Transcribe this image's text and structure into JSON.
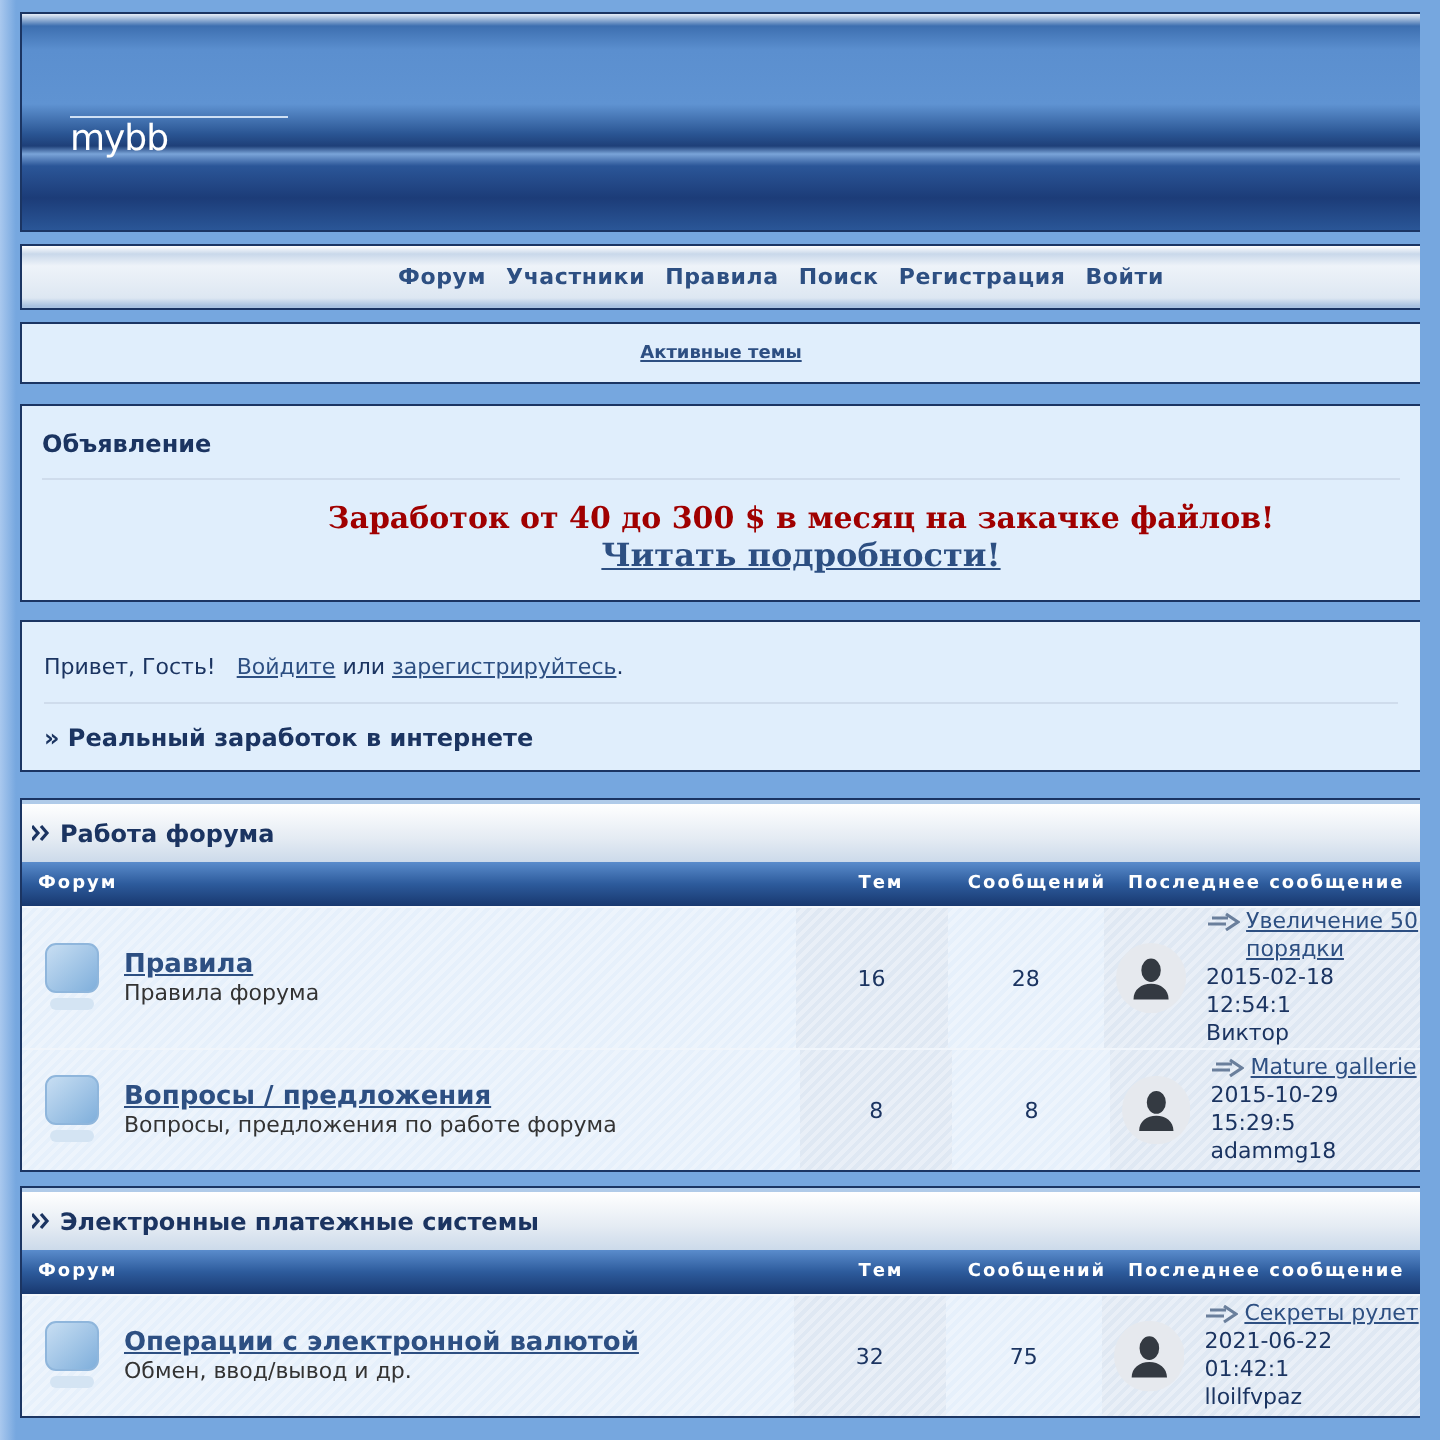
{
  "header": {
    "logo": "mybb"
  },
  "nav": {
    "links": [
      "Форум",
      "Участники",
      "Правила",
      "Поиск",
      "Регистрация",
      "Войти"
    ]
  },
  "active_topics": "Активные темы",
  "announcement": {
    "title": "Объявление",
    "headline": "Заработок от 40 до 300 $ в месяц на закачке файлов!",
    "link": "Читать подробности!"
  },
  "greeting": {
    "hello": "Привет, Гость!",
    "login": "Войдите",
    "or": "или",
    "register": "зарегистрируйтесь",
    "end": "."
  },
  "site_title": "» Реальный заработок в интернете",
  "categories": [
    {
      "title": "Работа форума",
      "columns": [
        "Форум",
        "Тем",
        "Сообщений",
        "Последнее сообщение"
      ],
      "forums": [
        {
          "title": "Правила",
          "description": "Правила форума",
          "topics": "16",
          "posts": "28",
          "last_post": {
            "title_lines": [
              "Увеличение 50",
              "порядки"
            ],
            "date": "2015-02-18 12:54:1",
            "author": "Виктор"
          }
        },
        {
          "title": "Вопросы / предложения",
          "description": "Вопросы, предложения по работе форума",
          "topics": "8",
          "posts": "8",
          "last_post": {
            "title_lines": [
              "Mature gallerie"
            ],
            "date": "2015-10-29 15:29:5",
            "author": "adammg18"
          }
        }
      ]
    },
    {
      "title": "Электронные платежные системы",
      "columns": [
        "Форум",
        "Тем",
        "Сообщений",
        "Последнее сообщение"
      ],
      "forums": [
        {
          "title": "Операции с электронной валютой",
          "description": "Обмен, ввод/вывод и др.",
          "topics": "32",
          "posts": "75",
          "last_post": {
            "title_lines": [
              "Секреты рулет"
            ],
            "date": "2021-06-22 01:42:1",
            "author": "lloilfvpaz"
          }
        }
      ]
    }
  ]
}
